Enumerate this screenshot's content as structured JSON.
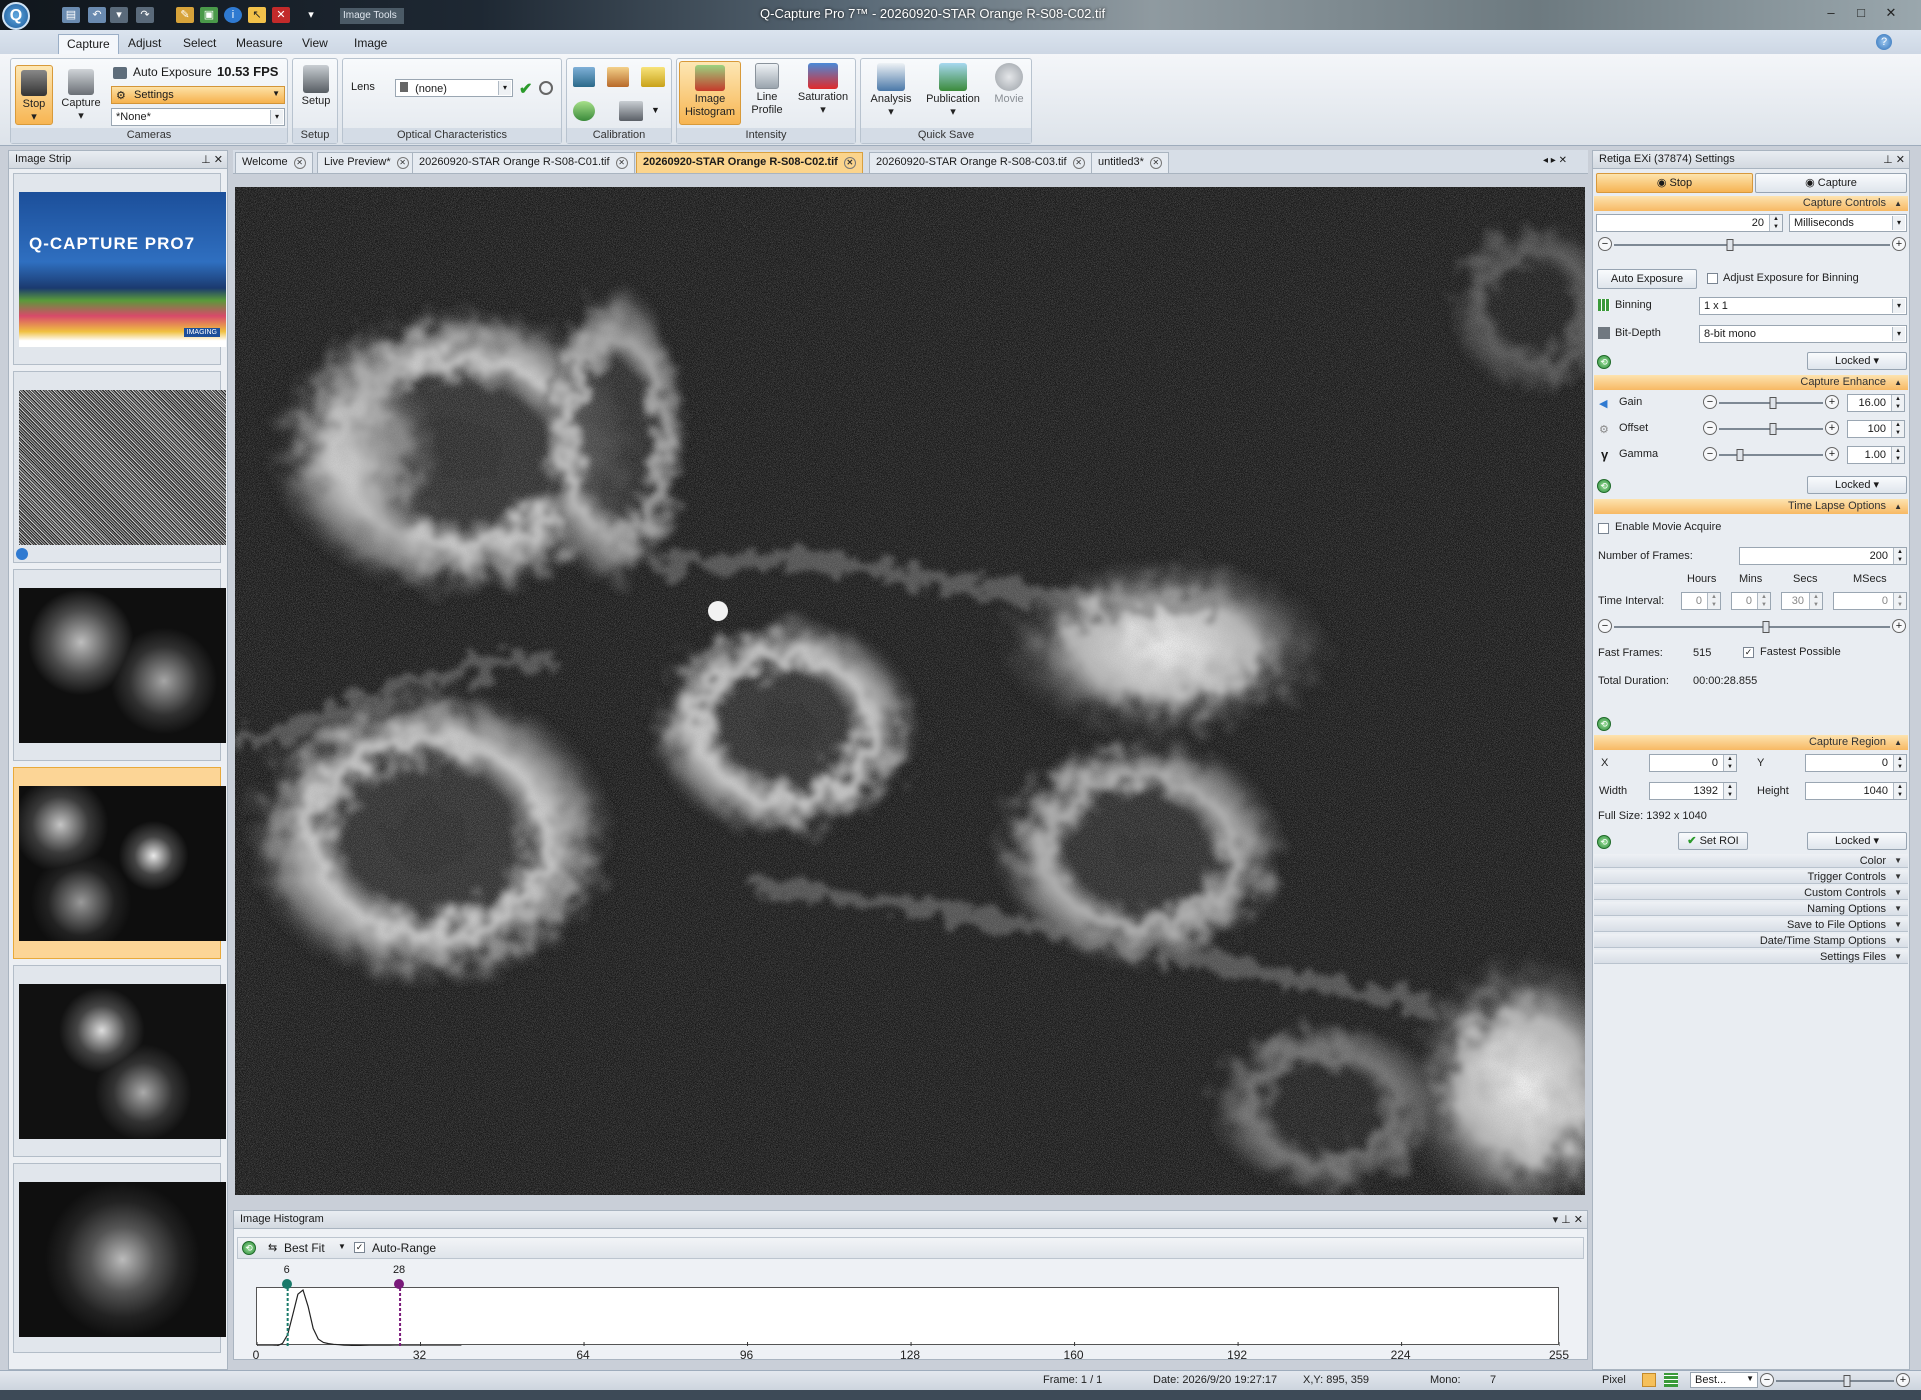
{
  "window": {
    "title": "Q-Capture Pro 7™ - 20260920-STAR Orange R-S08-C02.tif",
    "logo": "Q",
    "minimize": "–",
    "maximize": "□",
    "close": "✕"
  },
  "quick_access": {
    "image_tools_label": "Image Tools"
  },
  "menu": {
    "tabs": [
      "Capture",
      "Adjust",
      "Select",
      "Measure",
      "View",
      "Image"
    ],
    "active": "Capture"
  },
  "ribbon": {
    "cameras": {
      "stop_label": "Stop",
      "capture_label": "Capture",
      "auto_exposure_label": "Auto Exposure",
      "fps": "10.53 FPS",
      "settings_label": "Settings",
      "preset_value": "*None*",
      "group_label": "Cameras"
    },
    "setup": {
      "setup_label": "Setup",
      "group_label": "Setup"
    },
    "optical": {
      "lens_label": "Lens",
      "lens_value": "(none)",
      "group_label": "Optical Characteristics"
    },
    "calibration": {
      "group_label": "Calibration"
    },
    "intensity": {
      "image_histogram_label": "Image Histogram",
      "line_profile_label": "Line Profile",
      "saturation_label": "Saturation",
      "group_label": "Intensity"
    },
    "quick_save": {
      "analysis_label": "Analysis",
      "publication_label": "Publication",
      "movie_label": "Movie",
      "group_label": "Quick Save"
    }
  },
  "image_strip": {
    "title": "Image Strip",
    "splash_title": "Q-CAPTURE PRO7",
    "splash_subtitle": "IMAGING"
  },
  "doc_tabs": [
    "Welcome",
    "Live Preview*",
    "20260920-STAR Orange R-S08-C01.tif",
    "20260920-STAR Orange R-S08-C02.tif",
    "20260920-STAR Orange R-S08-C03.tif",
    "untitled3*"
  ],
  "active_doc_tab": "20260920-STAR Orange R-S08-C02.tif",
  "histogram": {
    "title": "Image Histogram",
    "fit_label": "Best Fit",
    "auto_range_label": "Auto-Range",
    "auto_range_checked": true,
    "low_marker": "6",
    "high_marker": "28",
    "ticks": [
      "0",
      "32",
      "64",
      "96",
      "128",
      "160",
      "192",
      "224",
      "255"
    ],
    "low_color": "#1a7a6a",
    "high_color": "#7a1a7a"
  },
  "settings": {
    "title": "Retiga EXi (37874) Settings",
    "stop_tab": "Stop",
    "capture_tab": "Capture",
    "capture_controls": {
      "heading": "Capture Controls",
      "exposure_value": "20",
      "exposure_unit": "Milliseconds",
      "exposure_slider": 0.42,
      "auto_exposure_btn": "Auto Exposure",
      "adjust_binning_label": "Adjust Exposure for Binning",
      "binning_label": "Binning",
      "binning_value": "1 x 1",
      "bitdepth_label": "Bit-Depth",
      "bitdepth_value": "8-bit mono",
      "locked": "Locked"
    },
    "capture_enhance": {
      "heading": "Capture Enhance",
      "gain_label": "Gain",
      "gain_value": "16.00",
      "gain_slider": 0.52,
      "offset_label": "Offset",
      "offset_value": "100",
      "offset_slider": 0.52,
      "gamma_label": "Gamma",
      "gamma_value": "1.00",
      "gamma_slider": 0.2,
      "locked": "Locked"
    },
    "time_lapse": {
      "heading": "Time Lapse Options",
      "enable_movie_label": "Enable Movie Acquire",
      "frames_label": "Number of Frames:",
      "frames_value": "200",
      "hours_label": "Hours",
      "mins_label": "Mins",
      "secs_label": "Secs",
      "msecs_label": "MSecs",
      "interval_label": "Time Interval:",
      "hours_value": "0",
      "mins_value": "0",
      "secs_value": "30",
      "msecs_value": "0",
      "interval_slider": 0.55,
      "fast_frames_label": "Fast Frames:",
      "fast_frames_value": "515",
      "fastest_label": "Fastest Possible",
      "duration_label": "Total Duration:",
      "duration_value": "00:00:28.855"
    },
    "capture_region": {
      "heading": "Capture Region",
      "x_label": "X",
      "x_value": "0",
      "y_label": "Y",
      "y_value": "0",
      "width_label": "Width",
      "width_value": "1392",
      "height_label": "Height",
      "height_value": "1040",
      "full_size": "Full Size: 1392 x 1040",
      "set_roi": "Set ROI",
      "locked": "Locked"
    },
    "collapsed": [
      "Color",
      "Trigger Controls",
      "Custom Controls",
      "Naming Options",
      "Save to File Options",
      "Date/Time Stamp Options",
      "Settings Files"
    ]
  },
  "status": {
    "frame": "Frame: 1 / 1",
    "date": "Date: 2026/9/20 19:27:17",
    "xy": "X,Y:  895,  359",
    "mono": "Mono:",
    "mono_value": "7",
    "pixel": "Pixel",
    "zoom": "Best..."
  }
}
